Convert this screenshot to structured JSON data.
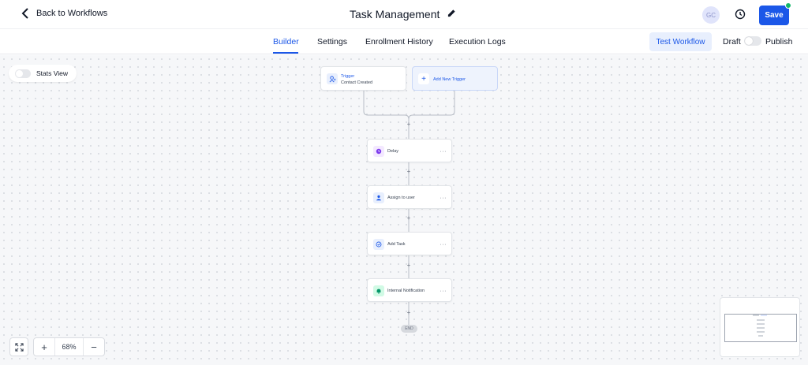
{
  "header": {
    "back_label": "Back to Workflows",
    "title": "Task Management",
    "avatar_initials": "GC",
    "save_label": "Save"
  },
  "tabs": [
    {
      "label": "Builder",
      "active": true
    },
    {
      "label": "Settings",
      "active": false
    },
    {
      "label": "Enrollment History",
      "active": false
    },
    {
      "label": "Execution Logs",
      "active": false
    }
  ],
  "actions": {
    "test_label": "Test Workflow",
    "draft_label": "Draft",
    "publish_label": "Publish"
  },
  "canvas": {
    "stats_label": "Stats View",
    "trigger": {
      "title": "Trigger",
      "subtitle": "Contact Created",
      "icon": "user-plus-icon"
    },
    "add_trigger_label": "Add New Trigger",
    "steps": [
      {
        "label": "Delay",
        "icon": "clock-icon",
        "color": "#7c3aed"
      },
      {
        "label": "Assign to user",
        "icon": "user-icon",
        "color": "#1b57e8"
      },
      {
        "label": "Add Task",
        "icon": "task-icon",
        "color": "#1b57e8"
      },
      {
        "label": "Internal Notification",
        "icon": "bell-icon",
        "color": "#059669"
      }
    ],
    "end_label": "END"
  },
  "zoom": {
    "value": "68%",
    "plus": "+",
    "minus": "−"
  },
  "colors": {
    "accent": "#1b57e8",
    "online": "#12b76a"
  }
}
